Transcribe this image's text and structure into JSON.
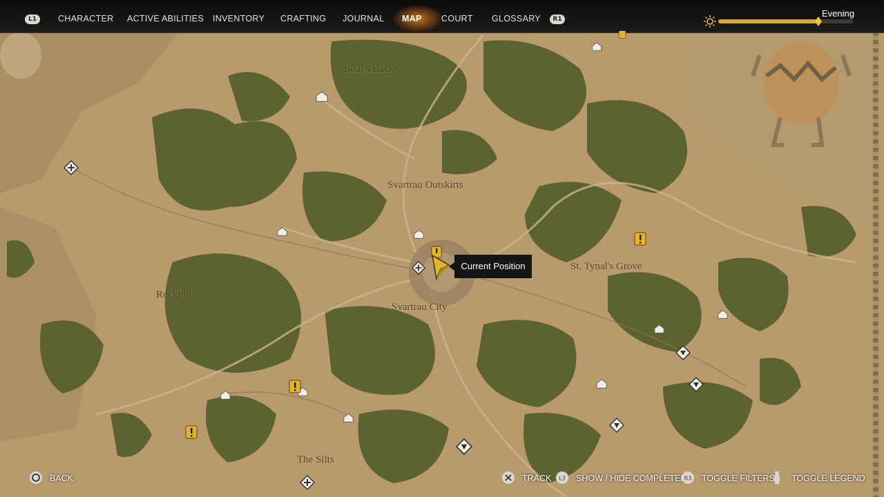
{
  "nav": {
    "left_bumper": "L1",
    "right_bumper": "R1",
    "tabs": [
      {
        "label": "CHARACTER"
      },
      {
        "label": "ACTIVE ABILITIES"
      },
      {
        "label": "INVENTORY"
      },
      {
        "label": "CRAFTING"
      },
      {
        "label": "JOURNAL"
      },
      {
        "label": "MAP",
        "active": true
      },
      {
        "label": "COURT"
      },
      {
        "label": "GLOSSARY"
      }
    ]
  },
  "time_of_day": {
    "label": "Evening",
    "progress": 0.74
  },
  "map": {
    "regions": [
      {
        "name": "Boar's Back"
      },
      {
        "name": "Svartrau Outskirts"
      },
      {
        "name": "St. Tynal's Grove"
      },
      {
        "name": "Rockfalls"
      },
      {
        "name": "Svartrau City"
      },
      {
        "name": "The Silts"
      }
    ],
    "tooltip": "Current Position"
  },
  "footer": {
    "back": {
      "button": "circle",
      "label": "BACK"
    },
    "track": {
      "button": "cross",
      "label": "TRACK"
    },
    "show_hide": {
      "button": "L3",
      "label": "SHOW / HIDE COMPLETED"
    },
    "filters": {
      "button": "R3",
      "label": "TOGGLE FILTERS"
    },
    "legend": {
      "button": "touchpad",
      "label": "TOGGLE LEGEND"
    }
  },
  "colors": {
    "accent": "#cfa93a",
    "forest": "#5c6331",
    "parchment": "#b89a6c",
    "quest": "#e2b62a"
  }
}
